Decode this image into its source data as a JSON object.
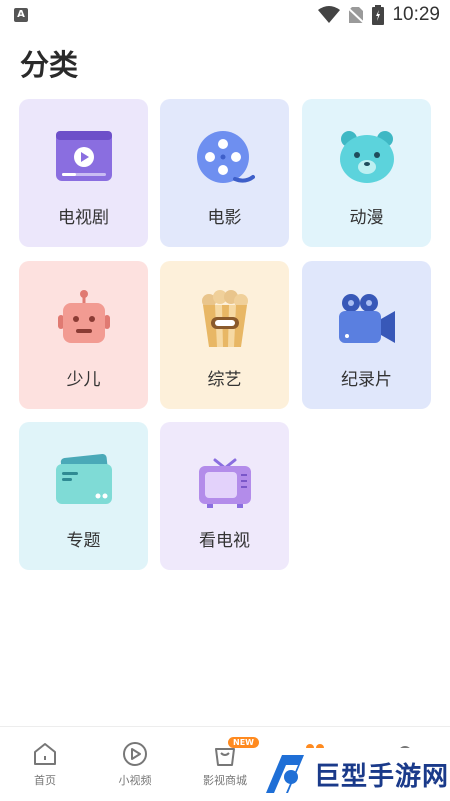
{
  "status_bar": {
    "time": "10:29"
  },
  "page_title": "分类",
  "categories": [
    {
      "label": "电视剧",
      "icon": "tv-series-icon",
      "bg": "#ece7fb"
    },
    {
      "label": "电影",
      "icon": "film-reel-icon",
      "bg": "#e2e8fb"
    },
    {
      "label": "动漫",
      "icon": "bear-face-icon",
      "bg": "#e1f4fb"
    },
    {
      "label": "少儿",
      "icon": "robot-icon",
      "bg": "#fde1df"
    },
    {
      "label": "综艺",
      "icon": "popcorn-icon",
      "bg": "#fdf0da"
    },
    {
      "label": "纪录片",
      "icon": "camera-icon",
      "bg": "#e0e7fb"
    },
    {
      "label": "专题",
      "icon": "folder-cards-icon",
      "bg": "#e0f4f9"
    },
    {
      "label": "看电视",
      "icon": "retro-tv-icon",
      "bg": "#efe9fb"
    }
  ],
  "bottom_nav": [
    {
      "label": "首页",
      "icon": "home-icon"
    },
    {
      "label": "小视频",
      "icon": "play-circle-icon"
    },
    {
      "label": "影视商城",
      "icon": "shop-bag-icon",
      "badge": "NEW"
    },
    {
      "label": "",
      "icon": "category-icon"
    },
    {
      "label": "",
      "icon": "profile-icon"
    }
  ],
  "watermark": {
    "text": "巨型手游网"
  }
}
